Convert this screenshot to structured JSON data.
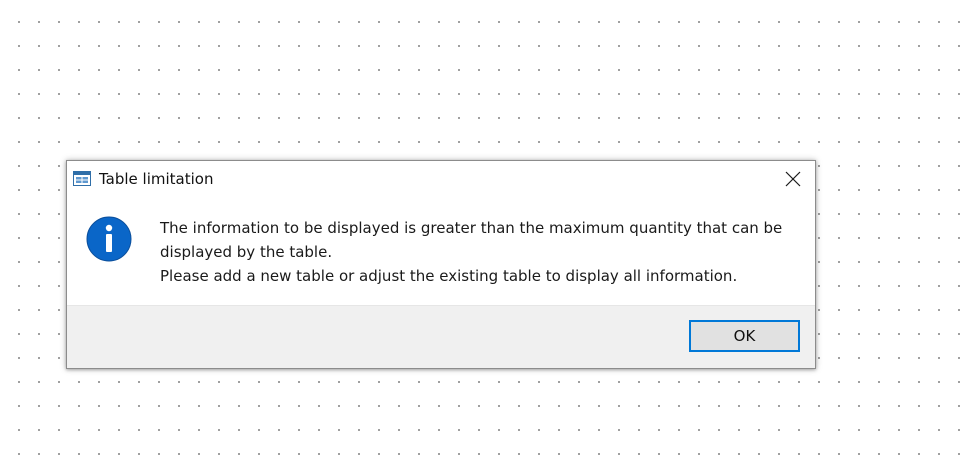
{
  "dialog": {
    "title": "Table limitation",
    "title_icon": "table-window-icon",
    "close_icon": "close-icon",
    "info_icon": "info-icon",
    "message_line1": "The information to be displayed is greater than the maximum quantity that can be displayed by the table.",
    "message_line2": "Please add a new table or adjust the existing table to display all information.",
    "ok_label": "OK",
    "colors": {
      "accent": "#0078d7",
      "info_blue": "#0a66c8",
      "footer_bg": "#f0f0f0",
      "button_bg": "#e1e1e1"
    }
  }
}
